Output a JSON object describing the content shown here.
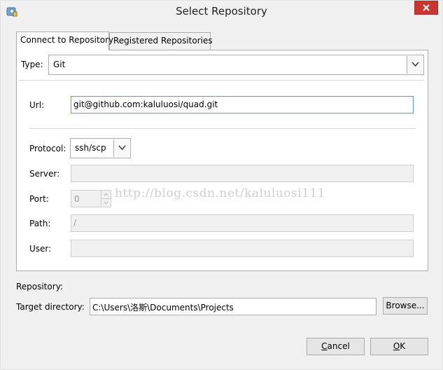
{
  "window": {
    "title": "Select Repository"
  },
  "tabs": [
    {
      "label": "Connect to Repository"
    },
    {
      "label": "Registered Repositories"
    }
  ],
  "type": {
    "label": "Type:",
    "value": "Git"
  },
  "url": {
    "label": "Url:",
    "value": "git@github.com:kaluluosi/quad.git"
  },
  "protocol": {
    "label": "Protocol:",
    "value": "ssh/scp"
  },
  "server": {
    "label": "Server:",
    "value": ""
  },
  "port": {
    "label": "Port:",
    "value": "0"
  },
  "path": {
    "label": "Path:",
    "value": "/"
  },
  "user": {
    "label": "User:",
    "value": ""
  },
  "watermark": "http://blog.csdn.net/kaluluosi111",
  "repository": {
    "label": "Repository:"
  },
  "target": {
    "label": "Target directory:",
    "value": "C:\\Users\\洛斯\\Documents\\Projects"
  },
  "buttons": {
    "browse": "Browse...",
    "cancel_first": "C",
    "cancel_rest": "ancel",
    "ok_first": "O",
    "ok_rest": "K"
  }
}
